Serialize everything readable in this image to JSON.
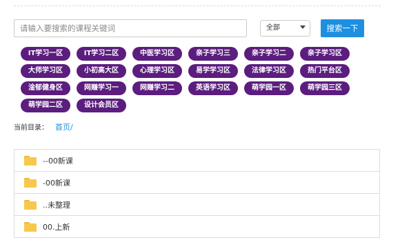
{
  "search": {
    "placeholder": "请输入要搜索的课程关键词",
    "scope_value": "全部",
    "button_label": "搜索一下"
  },
  "colors": {
    "tag_background": "#5b1d7e",
    "button_blue": "#1e8fe1",
    "folder_yellow": "#f6c94e"
  },
  "tags": [
    "IT学习一区",
    "IT学习二区",
    "中医学习区",
    "亲子学习三",
    "亲子学习二",
    "亲子学习区",
    "大师学习区",
    "小初高大区",
    "心理学习区",
    "易学学习区",
    "法律学习区",
    "热门平台区",
    "淦郁健身区",
    "网赚学习一",
    "网赚学习二",
    "英语学习区",
    "萌学园一区",
    "萌学园三区",
    "萌学园二区",
    "设计会员区"
  ],
  "breadcrumb": {
    "label": "当前目录：",
    "home": "首页",
    "separator": "/"
  },
  "folders": [
    {
      "name": "--00新课",
      "icon": "folder-icon"
    },
    {
      "name": "-00新课",
      "icon": "folder-icon"
    },
    {
      "name": "..未整理",
      "icon": "folder-icon"
    },
    {
      "name": "00.上新",
      "icon": "folder-icon"
    }
  ]
}
